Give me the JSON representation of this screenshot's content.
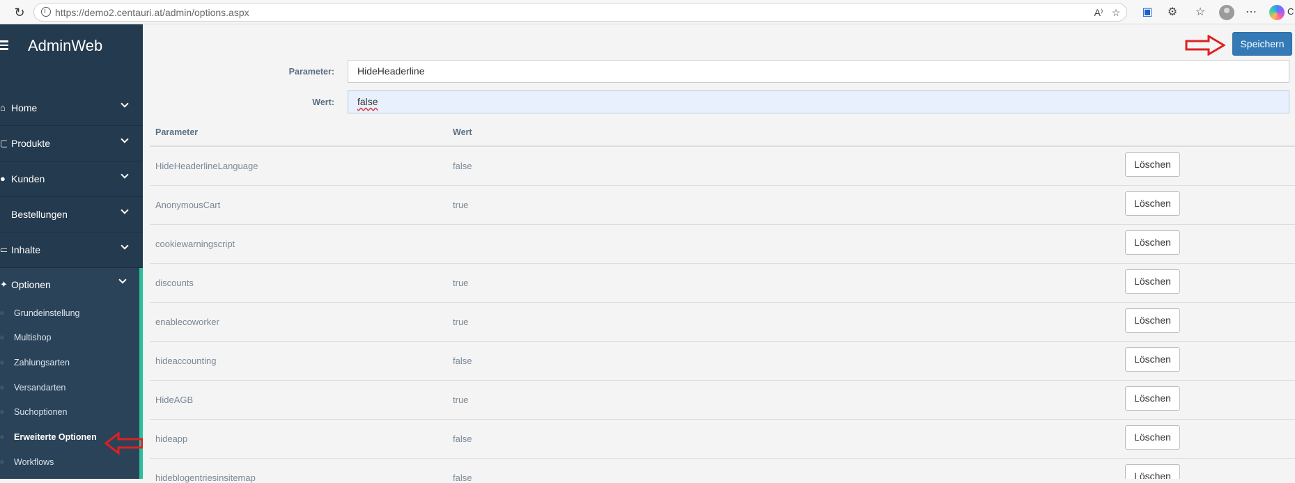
{
  "browser": {
    "url_host": "https://demo2.centauri.at",
    "url_path": "/admin/options.aspx",
    "copilot_letter": "C"
  },
  "sidebar": {
    "brand": "AdminWeb",
    "items": [
      {
        "label": "Home",
        "icon": "home-icon"
      },
      {
        "label": "Produkte",
        "icon": "box-icon"
      },
      {
        "label": "Kunden",
        "icon": "user-icon"
      },
      {
        "label": "Bestellungen",
        "icon": "cart-icon"
      },
      {
        "label": "Inhalte",
        "icon": "monitor-icon"
      },
      {
        "label": "Optionen",
        "icon": "puzzle-icon"
      }
    ],
    "subitems": [
      {
        "label": "Grundeinstellung"
      },
      {
        "label": "Multishop"
      },
      {
        "label": "Zahlungsarten"
      },
      {
        "label": "Versandarten"
      },
      {
        "label": "Suchoptionen"
      },
      {
        "label": "Erweiterte Optionen"
      },
      {
        "label": "Workflows"
      }
    ]
  },
  "toolbar": {
    "save_label": "Speichern"
  },
  "form": {
    "param_label": "Parameter:",
    "param_value": "HideHeaderline",
    "value_label": "Wert:",
    "value_value": "false"
  },
  "table": {
    "headers": [
      "Parameter",
      "Wert"
    ],
    "delete_label": "Löschen",
    "rows": [
      {
        "param": "HideHeaderlineLanguage",
        "value": "false"
      },
      {
        "param": "AnonymousCart",
        "value": "true"
      },
      {
        "param": "cookiewarningscript",
        "value": ""
      },
      {
        "param": "discounts",
        "value": "true"
      },
      {
        "param": "enablecoworker",
        "value": "true"
      },
      {
        "param": "hideaccounting",
        "value": "false"
      },
      {
        "param": "HideAGB",
        "value": "true"
      },
      {
        "param": "hideapp",
        "value": "false"
      },
      {
        "param": "hideblogentriesinsitemap",
        "value": "false"
      }
    ]
  },
  "colors": {
    "sidebar_bg": "#243a4e",
    "accent": "#2bbf9a",
    "primary_button": "#337ab7",
    "annotation_arrow": "#e02020"
  }
}
